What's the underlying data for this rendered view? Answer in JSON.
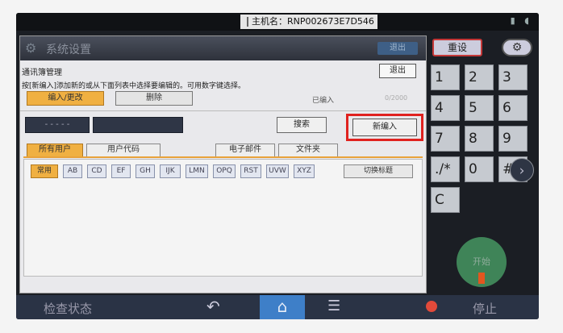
{
  "topbar": {
    "hostname": "主机名：RNP002673E7D546"
  },
  "panel": {
    "title": "系统设置",
    "title_exit": "退出",
    "subheader": "通讯簿管理",
    "exit": "退出",
    "instruction": "按[新编入]添加新的或从下面列表中选择要编辑的。可用数字键选择。",
    "edit_btn": "编入/更改",
    "delete_btn": "删除",
    "registered_label": "已编入",
    "registered_count": "0/2000",
    "search": "搜索",
    "new_entry": "新编入",
    "tabs": [
      "所有用户",
      "用户代码",
      "电子邮件",
      "文件夹"
    ],
    "chips": [
      "常用",
      "AB",
      "CD",
      "EF",
      "GH",
      "IJK",
      "LMN",
      "OPQ",
      "RST",
      "UVW",
      "XYZ"
    ],
    "switch_title": "切换标题"
  },
  "keypad": {
    "reset": "重设",
    "keys": [
      "1",
      "2",
      "3",
      "4",
      "5",
      "6",
      "7",
      "8",
      "9",
      "./*",
      "0",
      "#",
      "C"
    ],
    "start": "开始"
  },
  "bottombar": {
    "check_status": "检查状态",
    "stop": "停止"
  },
  "colors": {
    "accent_orange": "#f0b042",
    "highlight_red": "#e0221f",
    "home_blue": "#3e7fc8",
    "start_green": "#4ba66a"
  }
}
